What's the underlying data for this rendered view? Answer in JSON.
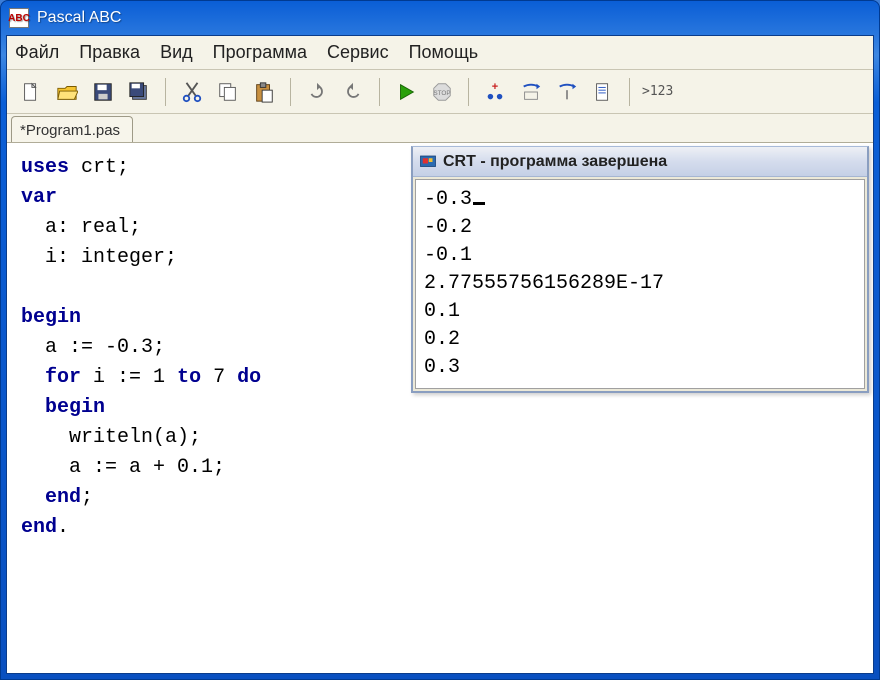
{
  "app": {
    "title": "Pascal ABC",
    "icon_label": "ABC"
  },
  "menu": {
    "items": [
      "Файл",
      "Правка",
      "Вид",
      "Программа",
      "Сервис",
      "Помощь"
    ]
  },
  "toolbar": {
    "buttons": [
      "new-file-icon",
      "open-file-icon",
      "save-icon",
      "save-all-icon",
      "cut-icon",
      "copy-icon",
      "paste-icon",
      "undo-icon",
      "redo-icon",
      "run-icon",
      "stop-icon",
      "step-over-icon",
      "step-into-icon",
      "step-out-icon",
      "breakpoint-icon",
      "goto-line-icon"
    ],
    "goto_label": ">123"
  },
  "tabs": {
    "items": [
      {
        "label": "*Program1.pas"
      }
    ]
  },
  "code": {
    "tokens": {
      "uses": "uses",
      "crt": "crt",
      "var": "var",
      "a_decl": "a: real;",
      "i_decl": "i: integer;",
      "begin": "begin",
      "a_assign": "a := -0.3;",
      "for": "for",
      "for_rest": "i := 1",
      "to": "to",
      "seven": "7",
      "do": "do",
      "begin2": "begin",
      "writeln": "writeln(a);",
      "a_inc": "a := a + 0.1;",
      "end1": "end",
      "end2": "end",
      "semi": ";",
      "dot": "."
    }
  },
  "crt": {
    "title": "CRT - программа завершена",
    "output": [
      "-0.3",
      "-0.2",
      "-0.1",
      "2.77555756156289E-17",
      "0.1",
      "0.2",
      "0.3"
    ]
  }
}
